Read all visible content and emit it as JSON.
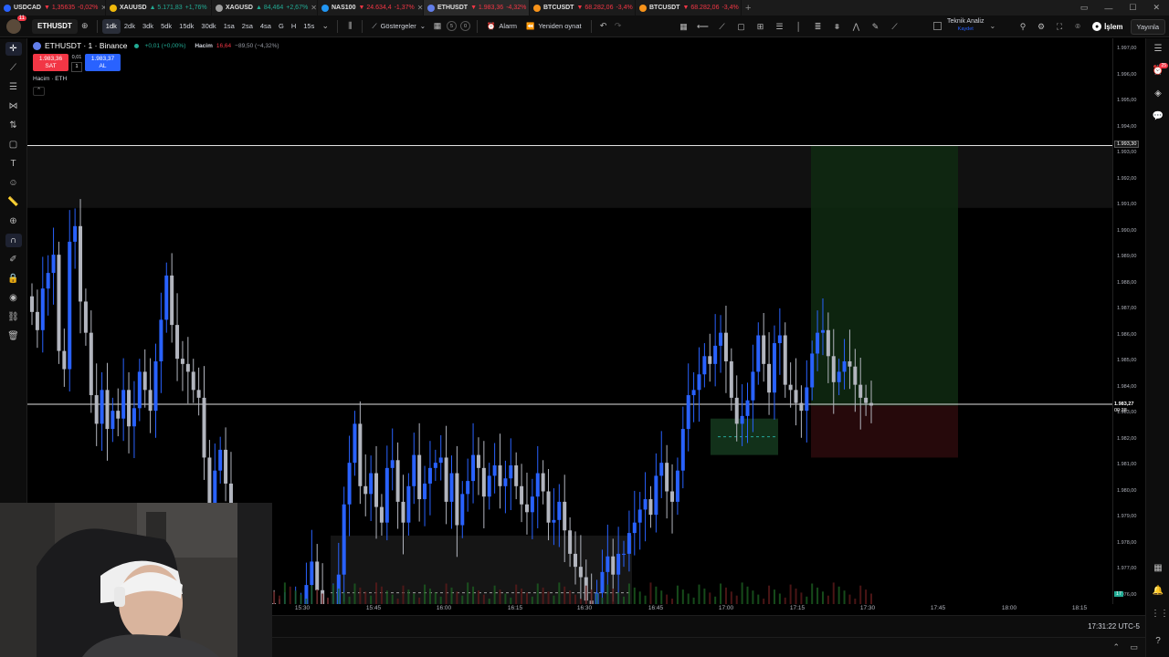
{
  "browser_tabs": [
    {
      "title": "USDCAD",
      "change": "▼ 1,35635",
      "pct": "-0,02%",
      "up": false,
      "color": "#2962ff"
    },
    {
      "title": "XAUUSD",
      "change": "▲ 5.171,83",
      "pct": "+1,76%",
      "up": true,
      "color": "#f0b90b"
    },
    {
      "title": "XAGUSD",
      "change": "▲ 84,464",
      "pct": "+2,67%",
      "up": true,
      "color": "#9e9e9e"
    },
    {
      "title": "NAS100",
      "change": "▼ 24.634,4",
      "pct": "-1,37%",
      "up": false,
      "color": "#2196f3"
    },
    {
      "title": "ETHUSDT",
      "change": "▼ 1.983,36",
      "pct": "-4,32%",
      "up": false,
      "color": "#627eea",
      "active": true
    },
    {
      "title": "BTCUSDT",
      "change": "▼ 68.282,06",
      "pct": "-3,4%",
      "up": false,
      "color": "#f7931a"
    },
    {
      "title": "BTCUSDT",
      "change": "▼ 68.282,06",
      "pct": "-3,4%",
      "up": false,
      "color": "#f7931a"
    }
  ],
  "toolbar": {
    "avatar_badge": "11",
    "symbol": "ETHUSDT",
    "timeframes": [
      "1dk",
      "2dk",
      "3dk",
      "5dk",
      "15dk",
      "30dk",
      "1sa",
      "2sa",
      "4sa",
      "G",
      "H",
      "15s"
    ],
    "active_timeframe": "1dk",
    "indicators_label": "Göstergeler",
    "alert_label": "Alarm",
    "replay_label": "Yeniden oynat",
    "layout_counts": [
      "5",
      "0"
    ],
    "analysis_name": "Teknik Analiz",
    "analysis_sub": "Kaydet",
    "trade_label": "İşlem",
    "publish_label": "Yayınla"
  },
  "legend": {
    "symbol": "ETHUSDT · 1 · Binance",
    "change": "+0,01 (+0,00%)",
    "volume_label": "Hacim",
    "volume_value": "16,64",
    "volume_change": "−89,50 (−4,32%)",
    "sell_price": "1.983,36",
    "sell_label": "SAT",
    "buy_price": "1.983,37",
    "buy_label": "AL",
    "spread": "0,01",
    "qty": "1",
    "study_label": "Hacim · ETH"
  },
  "price_axis": {
    "labels": [
      "1.997,00",
      "1.996,00",
      "1.995,00",
      "1.994,00",
      "1.993,00",
      "1.992,00",
      "1.991,00",
      "1.990,00",
      "1.989,00",
      "1.988,00",
      "1.987,00",
      "1.986,00",
      "1.985,00",
      "1.984,00",
      "1.983,00",
      "1.982,00",
      "1.981,00",
      "1.980,00",
      "1.979,00",
      "1.978,00",
      "1.977,00",
      "1.976,00"
    ],
    "horizontal_line_label": "1.993,30",
    "current_price": "1.983,27",
    "countdown": "00:38",
    "volume_badge": "17"
  },
  "time_axis": [
    "15:30",
    "15:45",
    "16:00",
    "16:15",
    "16:30",
    "16:45",
    "17:00",
    "17:15",
    "17:30",
    "17:45",
    "18:00",
    "18:15"
  ],
  "clock": "17:31:22 UTC-5",
  "chart_data": {
    "type": "candlestick",
    "symbol": "ETHUSDT",
    "exchange": "Binance",
    "interval": "1",
    "price_range": [
      1975.5,
      1997.0
    ],
    "horizontal_lines": [
      1993.3,
      1983.35
    ],
    "long_position": {
      "entry": 1983.3,
      "target": 1993.3,
      "stop": 1981.3,
      "start_time": "17:19",
      "end_time": "17:50"
    },
    "colors": {
      "up": "#2962ff",
      "down": "#b2b5be"
    },
    "closes": [
      1986.9,
      1986.2,
      1987.8,
      1988.4,
      1989.1,
      1985.4,
      1984.7,
      1989.6,
      1990.2,
      1987.3,
      1986.1,
      1983.7,
      1982.6,
      1983.9,
      1982.4,
      1983.1,
      1982.8,
      1983.9,
      1982.5,
      1983.2,
      1984.6,
      1983.9,
      1983.1,
      1985.0,
      1986.6,
      1988.3,
      1986.4,
      1985.1,
      1984.9,
      1984.6,
      1983.9,
      1983.6,
      1981.3,
      1979.4,
      1980.8,
      1981.6,
      1980.3,
      1978.2,
      1976.2,
      1975.3,
      1975.8,
      1977.0,
      1976.9,
      1975.2,
      1975.7,
      1975.0,
      1974.6,
      1974.9,
      1974.7,
      1975.3,
      1975.6,
      1976.4,
      1977.3,
      1976.2,
      1975.4,
      1974.9,
      1975.6,
      1976.8,
      1979.5,
      1981.1,
      1982.6,
      1980.2,
      1979.9,
      1980.7,
      1979.4,
      1978.8,
      1980.9,
      1981.2,
      1979.6,
      1978.8,
      1980.2,
      1981.4,
      1979.7,
      1980.3,
      1980.9,
      1981.1,
      1981.3,
      1979.6,
      1980.7,
      1978.7,
      1979.9,
      1980.4,
      1981.4,
      1980.9,
      1979.8,
      1980.6,
      1981.0,
      1980.2,
      1980.5,
      1981.0,
      1980.2,
      1979.5,
      1979.2,
      1979.8,
      1980.7,
      1980.0,
      1978.8,
      1978.9,
      1979.6,
      1978.5,
      1977.6,
      1977.1,
      1976.7,
      1975.8,
      1975.3,
      1976.1,
      1976.9,
      1977.5,
      1976.8,
      1977.6,
      1977.6,
      1978.4,
      1978.8,
      1979.3,
      1979.7,
      1979.1,
      1980.6,
      1981.1,
      1980.0,
      1979.6,
      1980.8,
      1982.4,
      1983.7,
      1983.9,
      1984.5,
      1985.2,
      1984.9,
      1985.6,
      1986.1,
      1985.0,
      1983.6,
      1982.6,
      1982.9,
      1983.5,
      1984.6,
      1986.0,
      1984.9,
      1983.8,
      1985.7,
      1986.0,
      1984.1,
      1983.9,
      1983.4,
      1983.1,
      1984.0,
      1985.3,
      1986.1,
      1986.2,
      1985.2,
      1984.2,
      1984.6,
      1985.0,
      1984.8,
      1984.1,
      1983.6,
      1983.4,
      1983.3
    ]
  }
}
